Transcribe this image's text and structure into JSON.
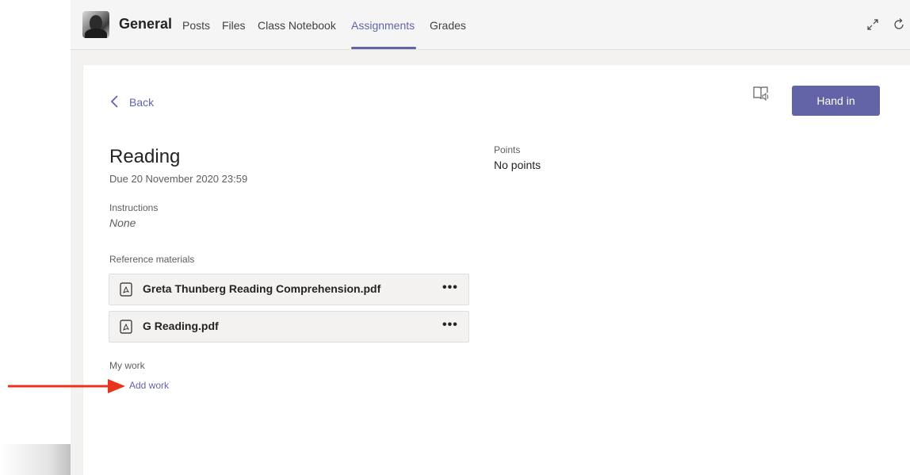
{
  "header": {
    "channel_name": "General",
    "tabs": [
      {
        "label": "Posts",
        "active": false
      },
      {
        "label": "Files",
        "active": false
      },
      {
        "label": "Class Notebook",
        "active": false
      },
      {
        "label": "Assignments",
        "active": true
      },
      {
        "label": "Grades",
        "active": false
      }
    ],
    "icons": [
      "expand-icon",
      "refresh-icon"
    ],
    "accent_color": "#6264a7"
  },
  "assignment": {
    "back_label": "Back",
    "hand_in_label": "Hand in",
    "title": "Reading",
    "due": "Due 20 November 2020 23:59",
    "points_label": "Points",
    "points_value": "No points",
    "instructions_label": "Instructions",
    "instructions_value": "None",
    "reference_label": "Reference materials",
    "files": [
      {
        "name": "Greta Thunberg Reading Comprehension.pdf",
        "more": "•••"
      },
      {
        "name": "G Reading.pdf",
        "more": "•••"
      }
    ],
    "my_work_label": "My work",
    "add_work_label": "Add work"
  },
  "annotation": {
    "arrow_color": "#e8341c"
  }
}
